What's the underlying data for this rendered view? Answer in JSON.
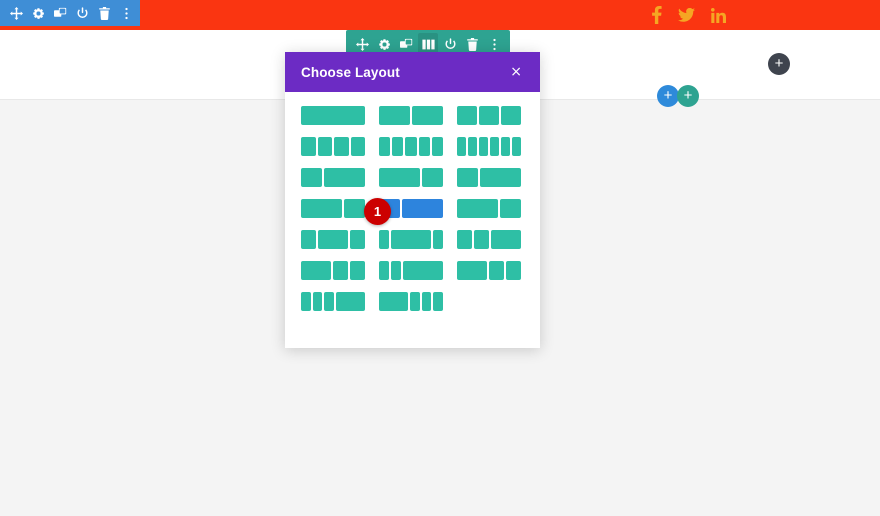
{
  "page": {
    "top_bar_color": "#fa3511",
    "accent_teal": "#2ebfa5",
    "accent_blue": "#2d84dd",
    "modal_header_color": "#6c2bc4"
  },
  "module_toolbar": {
    "icons": [
      {
        "name": "move-icon",
        "label": "Move"
      },
      {
        "name": "gear-icon",
        "label": "Settings"
      },
      {
        "name": "duplicate-icon",
        "label": "Duplicate"
      },
      {
        "name": "power-icon",
        "label": "Disable"
      },
      {
        "name": "trash-icon",
        "label": "Delete"
      },
      {
        "name": "more-options-icon",
        "label": "More Options"
      }
    ]
  },
  "row_toolbar": {
    "icons": [
      {
        "name": "move-icon",
        "label": "Move"
      },
      {
        "name": "gear-icon",
        "label": "Settings"
      },
      {
        "name": "duplicate-icon",
        "label": "Duplicate"
      },
      {
        "name": "choose-layout-icon",
        "label": "Choose Layout"
      },
      {
        "name": "power-icon",
        "label": "Disable"
      },
      {
        "name": "trash-icon",
        "label": "Delete"
      },
      {
        "name": "more-options-icon",
        "label": "More Options"
      }
    ],
    "active_index": 3
  },
  "social": {
    "icons": [
      {
        "name": "facebook-icon",
        "label": "Facebook"
      },
      {
        "name": "twitter-icon",
        "label": "Twitter"
      },
      {
        "name": "linkedin-icon",
        "label": "LinkedIn"
      }
    ],
    "color": "#f5a623"
  },
  "add_buttons": [
    {
      "name": "add-section-dark-button",
      "glyph": "+",
      "color": "#3f444e"
    },
    {
      "name": "add-row-blue-button",
      "glyph": "+",
      "color": "#2e8ada"
    },
    {
      "name": "add-module-teal-button",
      "glyph": "+",
      "color": "#2ea391"
    }
  ],
  "modal": {
    "title": "Choose Layout",
    "close_label": "×",
    "layouts": [
      [
        {
          "name": "layout-1-col",
          "columns": [
            1
          ]
        },
        {
          "name": "layout-2-col",
          "columns": [
            1,
            1
          ]
        },
        {
          "name": "layout-3-col",
          "columns": [
            1,
            1,
            1
          ]
        }
      ],
      [
        {
          "name": "layout-4-col",
          "columns": [
            1,
            1,
            1,
            1
          ]
        },
        {
          "name": "layout-5-col",
          "columns": [
            1,
            1,
            1,
            1,
            1
          ]
        },
        {
          "name": "layout-6-col",
          "columns": [
            1,
            1,
            1,
            1,
            1,
            1
          ]
        }
      ],
      [
        {
          "name": "layout-1-3-2-3",
          "columns": [
            1,
            2
          ]
        },
        {
          "name": "layout-2-3-1-3",
          "columns": [
            2,
            1
          ]
        },
        {
          "name": "layout-1-4-3-4",
          "columns": [
            1,
            2
          ]
        }
      ],
      [
        {
          "name": "layout-2-3-1-3-b",
          "columns": [
            2,
            1
          ]
        },
        {
          "name": "layout-1-3-2-3-hovered",
          "columns": [
            1,
            2
          ],
          "hovered": true
        },
        {
          "name": "layout-2-3-1-3-c",
          "columns": [
            2,
            1
          ]
        }
      ],
      [
        {
          "name": "layout-1-4-1-2-1-4",
          "columns": [
            1,
            2,
            1
          ]
        },
        {
          "name": "layout-1-6-2-3-1-6",
          "columns": [
            1,
            4,
            1
          ]
        },
        {
          "name": "layout-1-4-1-4-1-2",
          "columns": [
            1,
            1,
            2
          ]
        }
      ],
      [
        {
          "name": "layout-1-2-1-4-1-4",
          "columns": [
            2,
            1,
            1
          ]
        },
        {
          "name": "layout-1-6-1-6-2-3",
          "columns": [
            1,
            1,
            4
          ]
        },
        {
          "name": "layout-1-2-1-4-1-4-b",
          "columns": [
            2,
            1,
            1
          ]
        }
      ],
      [
        {
          "name": "layout-1-6-1-6-1-6-1-2",
          "columns": [
            1,
            1,
            1,
            3
          ]
        },
        {
          "name": "layout-1-2-1-6-1-6-1-6",
          "columns": [
            3,
            1,
            1,
            1
          ]
        }
      ]
    ]
  },
  "step_badge": {
    "number": "1"
  }
}
